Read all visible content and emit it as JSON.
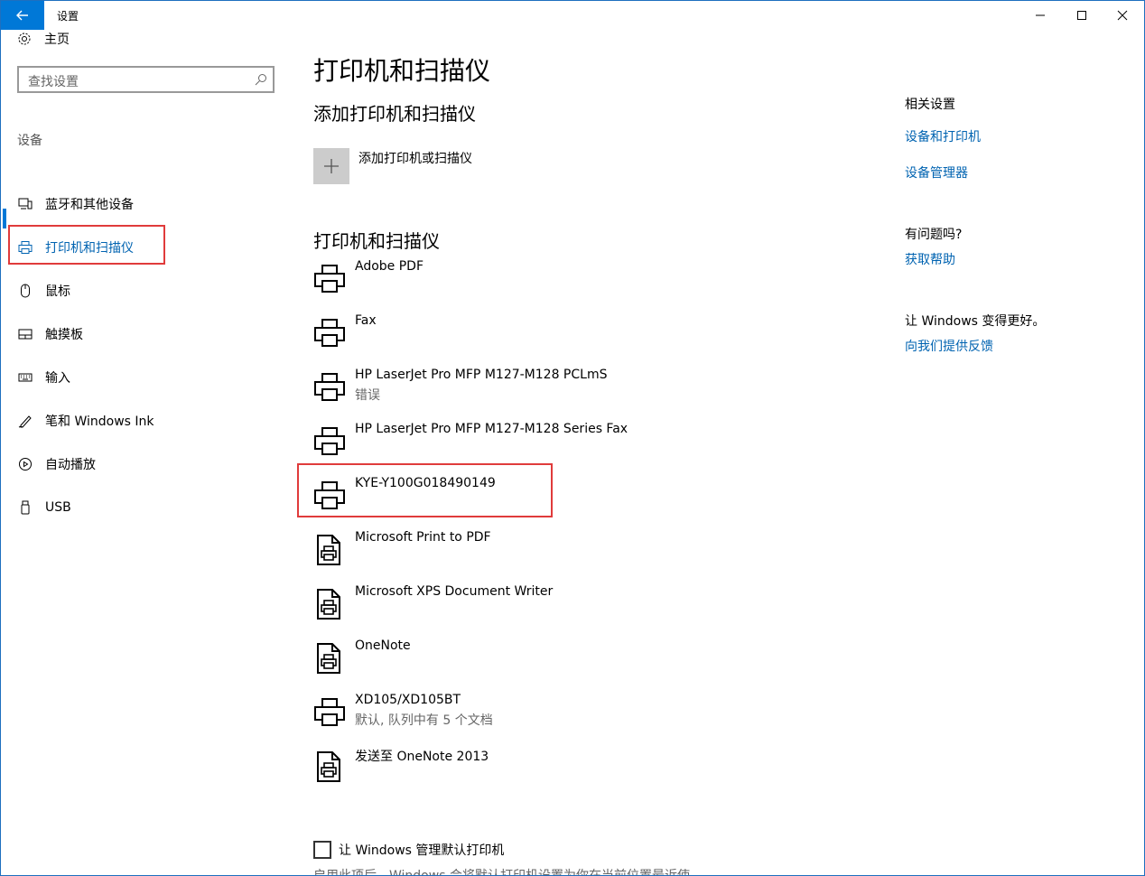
{
  "window": {
    "title": "设置",
    "accent": "#0078d7",
    "controls": [
      "minimize",
      "maximize",
      "close"
    ]
  },
  "sidebar": {
    "home_label": "主页",
    "search_placeholder": "查找设置",
    "section_label": "设备",
    "items": [
      {
        "label": "蓝牙和其他设备",
        "icon": "bluetooth-devices-icon"
      },
      {
        "label": "打印机和扫描仪",
        "icon": "printer-icon",
        "active": true
      },
      {
        "label": "鼠标",
        "icon": "mouse-icon"
      },
      {
        "label": "触摸板",
        "icon": "touchpad-icon"
      },
      {
        "label": "输入",
        "icon": "keyboard-icon"
      },
      {
        "label": "笔和 Windows Ink",
        "icon": "pen-icon"
      },
      {
        "label": "自动播放",
        "icon": "autoplay-icon"
      },
      {
        "label": "USB",
        "icon": "usb-icon"
      }
    ]
  },
  "main": {
    "page_title": "打印机和扫描仪",
    "add_section_title": "添加打印机和扫描仪",
    "add_button_label": "添加打印机或扫描仪",
    "list_section_title": "打印机和扫描仪",
    "printers": [
      {
        "name": "Adobe PDF",
        "status": "",
        "icon": "printer-icon"
      },
      {
        "name": "Fax",
        "status": "",
        "icon": "printer-icon"
      },
      {
        "name": "HP LaserJet Pro MFP M127-M128 PCLmS",
        "status": "错误",
        "icon": "printer-icon"
      },
      {
        "name": "HP LaserJet Pro MFP M127-M128 Series Fax",
        "status": "",
        "icon": "printer-icon"
      },
      {
        "name": "KYE-Y100G018490149",
        "status": "",
        "icon": "printer-icon"
      },
      {
        "name": "Microsoft Print to PDF",
        "status": "",
        "icon": "document-printer-icon"
      },
      {
        "name": "Microsoft XPS Document Writer",
        "status": "",
        "icon": "document-printer-icon"
      },
      {
        "name": "OneNote",
        "status": "",
        "icon": "document-printer-icon"
      },
      {
        "name": "XD105/XD105BT",
        "status": "默认, 队列中有 5 个文档",
        "icon": "printer-icon"
      },
      {
        "name": "发送至 OneNote 2013",
        "status": "",
        "icon": "document-printer-icon"
      }
    ],
    "checkbox_label": "让 Windows 管理默认打印机",
    "cutoff_text": "启用此项后，Windows 会将默认打印机设置为你在当前位置最近使"
  },
  "related": {
    "title": "相关设置",
    "links": [
      "设备和打印机",
      "设备管理器"
    ],
    "help_title": "有问题吗?",
    "help_link": "获取帮助",
    "feedback_title": "让 Windows 变得更好。",
    "feedback_link": "向我们提供反馈"
  }
}
